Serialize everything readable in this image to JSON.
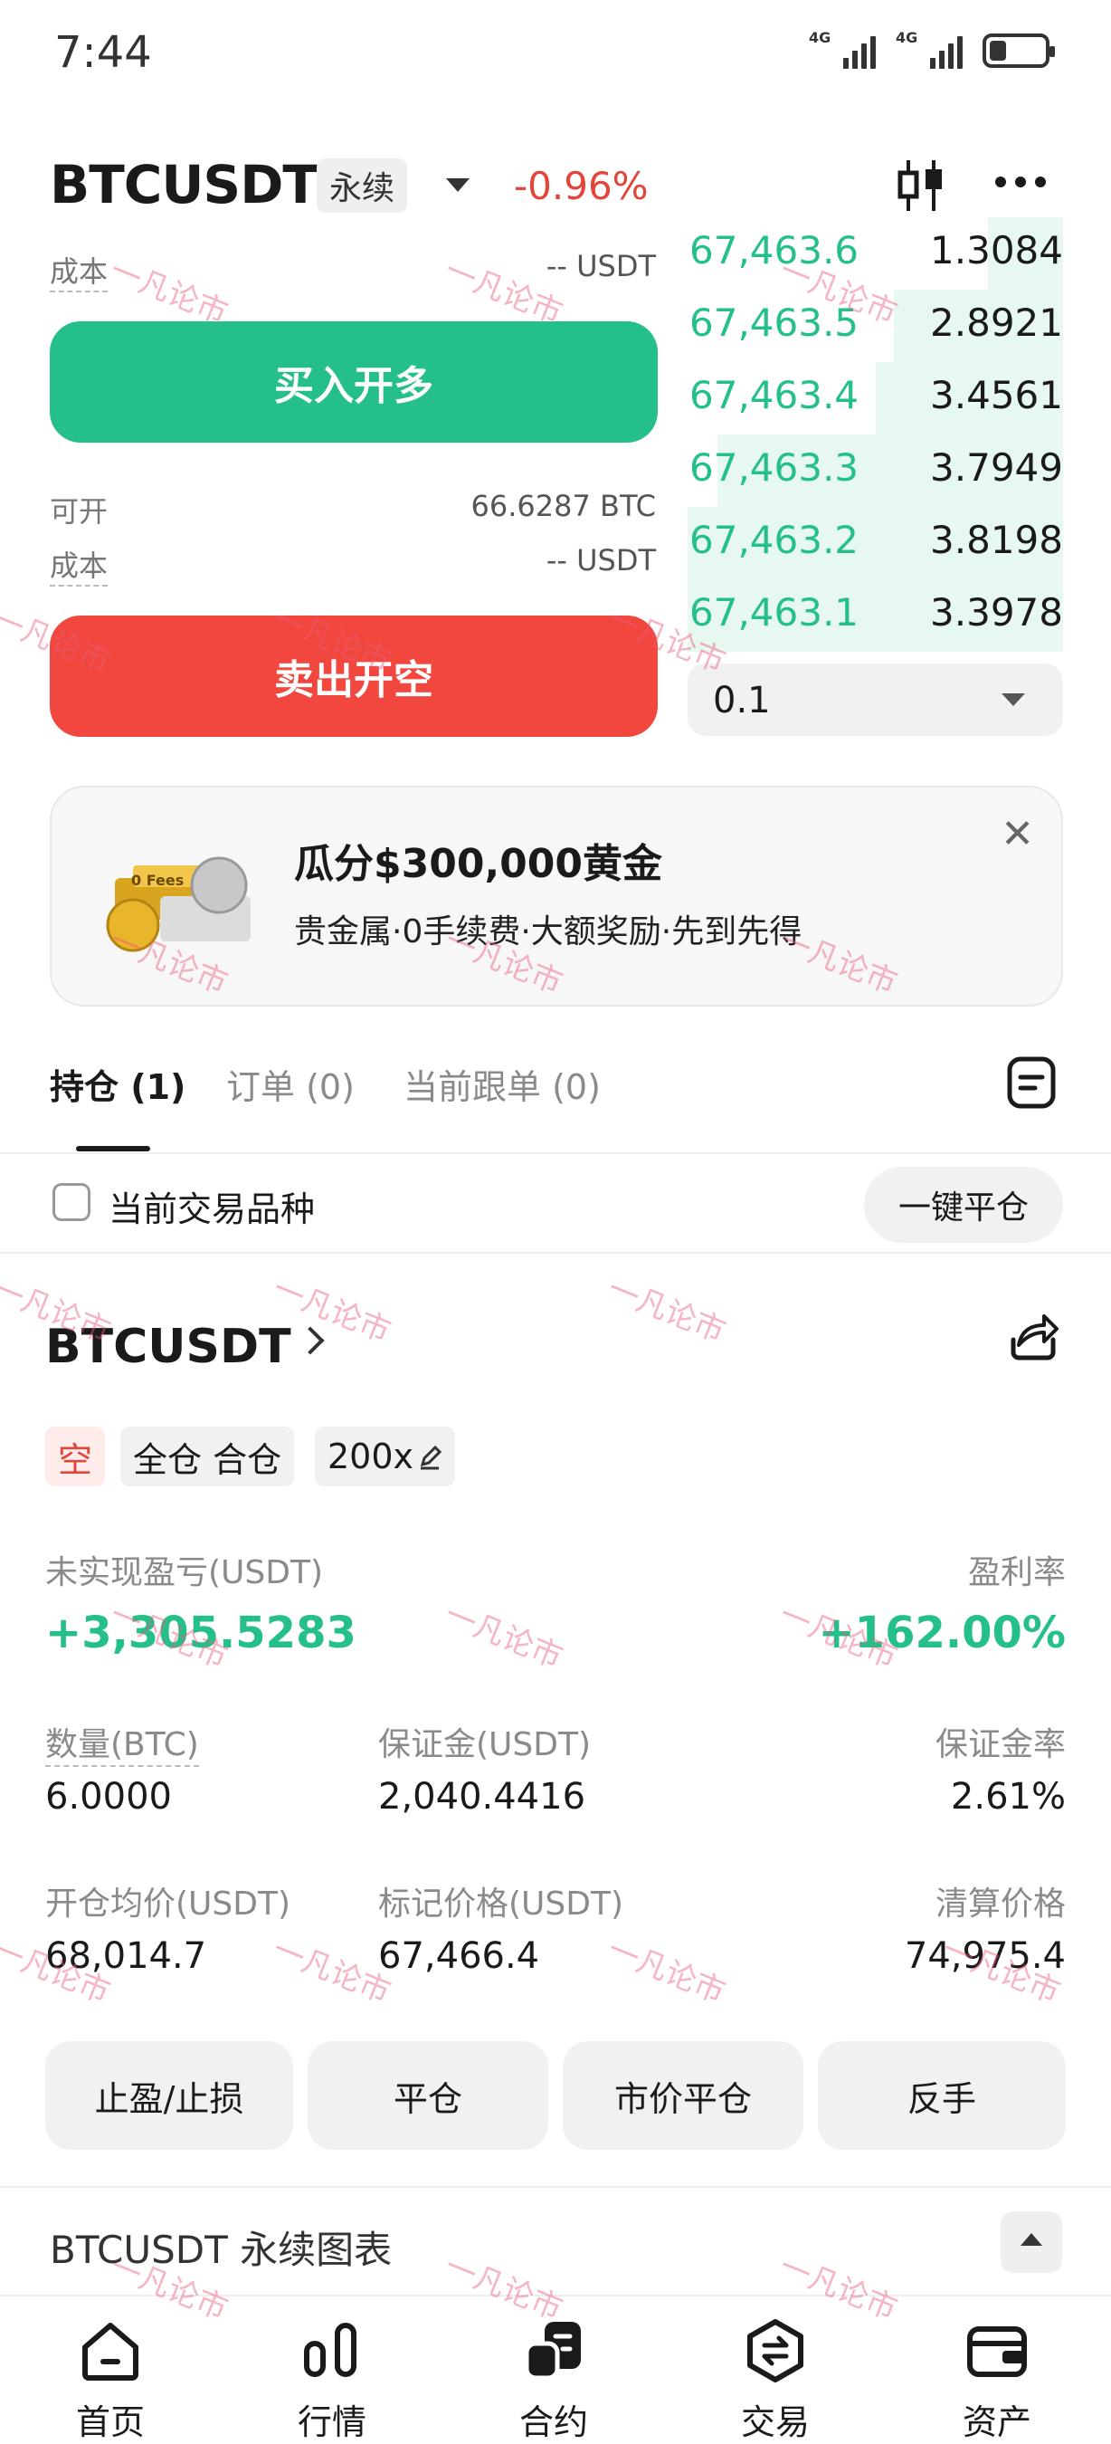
{
  "status_bar": {
    "time": "7:44",
    "network_1": "4G",
    "network_2": "4G"
  },
  "header": {
    "pair": "BTCUSDT",
    "contract_type": "永续",
    "change_pct": "-0.96%"
  },
  "trade_panel": {
    "cost_label": "成本",
    "cost_value_top": "-- USDT",
    "buy_label": "买入开多",
    "available_label": "可开",
    "available_value": "66.6287 BTC",
    "cost_value_bottom": "-- USDT",
    "sell_label": "卖出开空"
  },
  "orderbook": {
    "rows": [
      {
        "price": "67,463.6",
        "qty": "1.3084",
        "depth": 0.2
      },
      {
        "price": "67,463.5",
        "qty": "2.8921",
        "depth": 0.45
      },
      {
        "price": "67,463.4",
        "qty": "3.4561",
        "depth": 0.5
      },
      {
        "price": "67,463.3",
        "qty": "3.7949",
        "depth": 0.92
      },
      {
        "price": "67,463.2",
        "qty": "3.8198",
        "depth": 1.0
      },
      {
        "price": "67,463.1",
        "qty": "3.3978",
        "depth": 1.0
      }
    ],
    "precision": "0.1"
  },
  "promo": {
    "title": "瓜分$300,000黄金",
    "subtitle": "贵金属·0手续费·大额奖励·先到先得",
    "close": "✕",
    "image_text": "0 Fees"
  },
  "tabs": [
    "持仓 (1)",
    "订单 (0)",
    "当前跟单 (0)"
  ],
  "filter": {
    "label": "当前交易品种",
    "close_all": "一键平仓"
  },
  "position": {
    "name": "BTCUSDT",
    "side": "空",
    "margin_mode": "全仓 合仓",
    "leverage": "200x",
    "unrealized_pnl_label": "未实现盈亏(USDT)",
    "unrealized_pnl": "+3,305.5283",
    "roe_label": "盈利率",
    "roe": "+162.00%",
    "qty_label": "数量(BTC)",
    "qty": "6.0000",
    "margin_label": "保证金(USDT)",
    "margin": "2,040.4416",
    "margin_ratio_label": "保证金率",
    "margin_ratio": "2.61%",
    "entry_label": "开仓均价(USDT)",
    "entry": "68,014.7",
    "mark_label": "标记价格(USDT)",
    "mark": "67,466.4",
    "liq_label": "清算价格",
    "liq": "74,975.4"
  },
  "actions": [
    "止盈/止损",
    "平仓",
    "市价平仓",
    "反手"
  ],
  "chart_section": {
    "title": "BTCUSDT 永续图表"
  },
  "bottom_nav": [
    "首页",
    "行情",
    "合约",
    "交易",
    "资产"
  ],
  "watermark": "一凡论市",
  "colors": {
    "green": "#25c08a",
    "red": "#f1473e",
    "gray_bg": "#f1f1f1"
  }
}
